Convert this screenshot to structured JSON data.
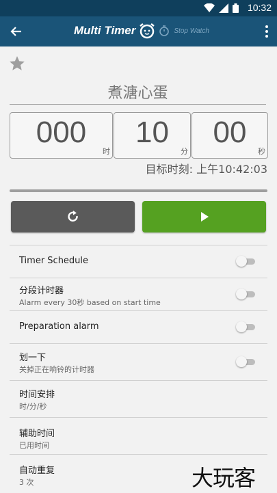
{
  "status_bar": {
    "time": "10:32"
  },
  "app_bar": {
    "title": "Multi Timer",
    "subtitle": "Stop Watch"
  },
  "timer": {
    "name": "煮溏心蛋",
    "hours": "000",
    "hours_unit": "时",
    "minutes": "10",
    "minutes_unit": "分",
    "seconds": "00",
    "seconds_unit": "秒",
    "target_time": "目标时刻: 上午10:42:03"
  },
  "settings": [
    {
      "title": "Timer Schedule",
      "subtitle": "",
      "toggle": false
    },
    {
      "title": "分段计时器",
      "subtitle": "Alarm every 30秒 based on start time",
      "toggle": false
    },
    {
      "title": "Preparation alarm",
      "subtitle": "",
      "toggle": false
    },
    {
      "title": "划一下",
      "subtitle": "关掉正在响铃的计时器",
      "toggle": false
    },
    {
      "title": "时间安排",
      "subtitle": "时/分/秒"
    },
    {
      "title": "辅助时间",
      "subtitle": "已用时间"
    },
    {
      "title": "自动重复",
      "subtitle": "3 次"
    }
  ],
  "watermark": "大玩客",
  "colors": {
    "status_bar": "#0f3f5c",
    "app_bar": "#1a5478",
    "start_button": "#55a121",
    "reset_button": "#5a5a5a"
  }
}
